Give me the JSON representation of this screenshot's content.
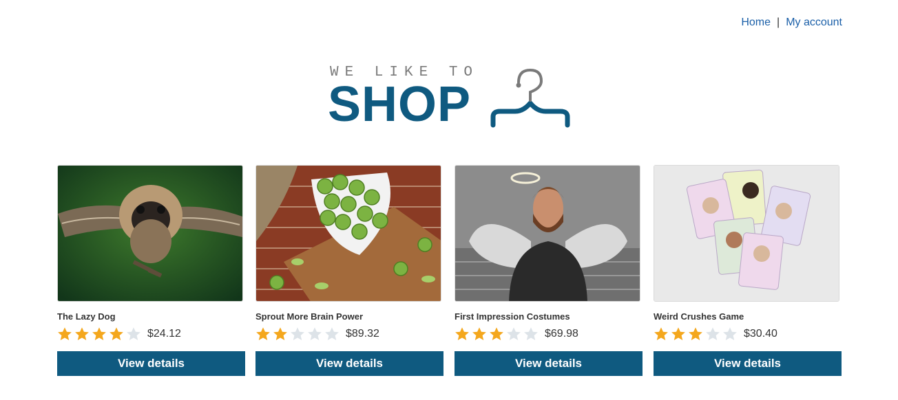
{
  "nav": {
    "home": "Home",
    "separator": "|",
    "account": "My account"
  },
  "logo": {
    "tagline": "WE LIKE TO",
    "word": "SHOP",
    "icon": "hanger-icon"
  },
  "colors": {
    "brand": "#0f5a80",
    "link": "#1a5fa8",
    "star_on": "#f4a71d",
    "star_off": "#dde3e8"
  },
  "products": [
    {
      "name": "The Lazy Dog",
      "rating": 4,
      "max_rating": 5,
      "price": "$24.12",
      "button": "View details",
      "image": "flying-pug-image"
    },
    {
      "name": "Sprout More Brain Power",
      "rating": 2,
      "max_rating": 5,
      "price": "$89.32",
      "button": "View details",
      "image": "brussels-sprouts-image"
    },
    {
      "name": "First Impression Costumes",
      "rating": 3,
      "max_rating": 5,
      "price": "$69.98",
      "button": "View details",
      "image": "angel-man-image"
    },
    {
      "name": "Weird Crushes Game",
      "rating": 3,
      "max_rating": 5,
      "price": "$30.40",
      "button": "View details",
      "image": "trading-cards-image"
    }
  ]
}
